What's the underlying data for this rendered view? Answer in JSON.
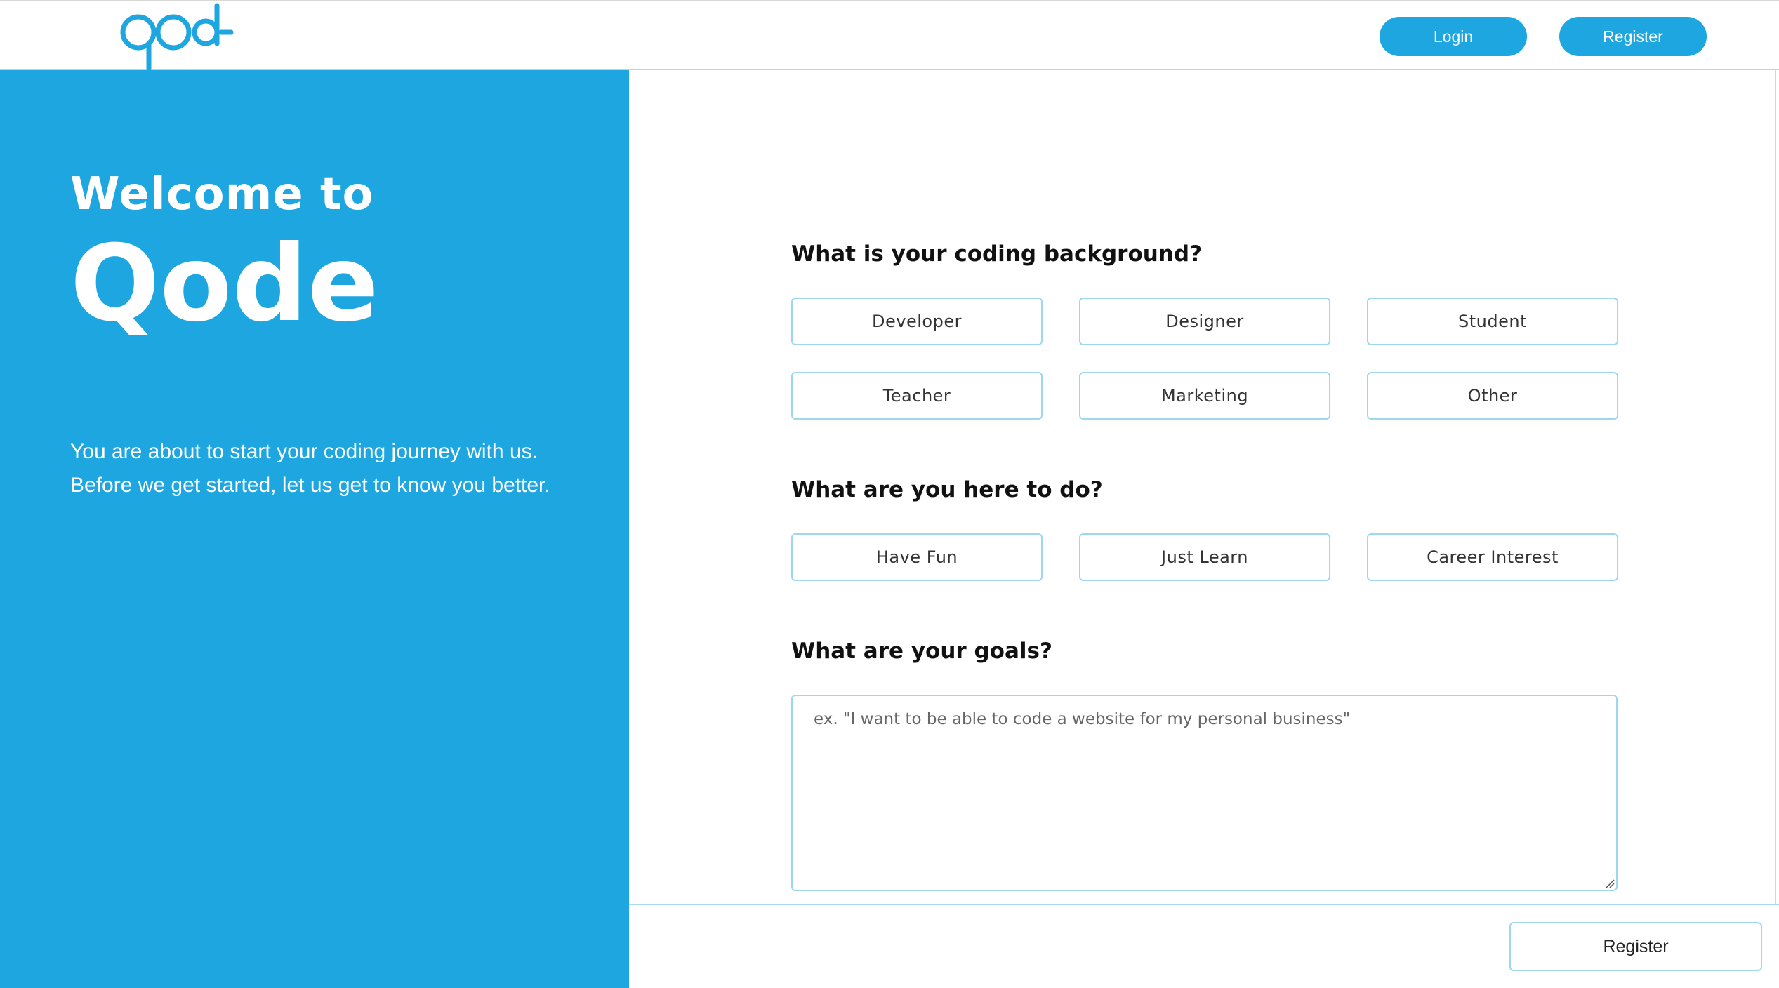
{
  "header": {
    "logo_text": "qode",
    "login_label": "Login",
    "register_label": "Register"
  },
  "hero": {
    "welcome": "Welcome to",
    "brand": "Qode",
    "intro_line1": "You are about to start your coding journey with us.",
    "intro_line2": "Before we get started, let us get to know you better."
  },
  "form": {
    "background_question": "What is your coding background?",
    "background_options": [
      "Developer",
      "Designer",
      "Student",
      "Teacher",
      "Marketing",
      "Other"
    ],
    "purpose_question": "What are you here to do?",
    "purpose_options": [
      "Have Fun",
      "Just Learn",
      "Career Interest"
    ],
    "goals_question": "What are your goals?",
    "goals_placeholder": "ex. \"I want to be able to code a website for my personal business\"",
    "goals_value": "",
    "submit_label": "Register"
  },
  "colors": {
    "brand_blue": "#1da6df",
    "border_blue": "#9fd6f0"
  },
  "icons": {
    "logo": "qode-logo-icon",
    "resize": "resize-grip-icon"
  }
}
